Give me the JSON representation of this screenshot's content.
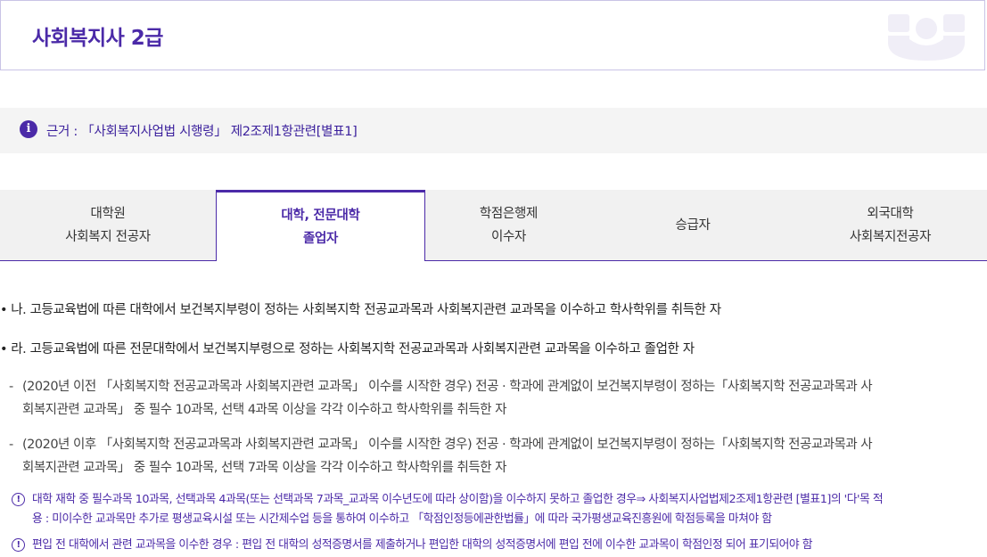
{
  "header": {
    "title": "사회복지사 2급",
    "logo_icon": "brand-logo-icon"
  },
  "notice": {
    "icon": "info-icon",
    "text": "근거 : 「사회복지사업법 시행령」 제2조제1항관련[별표1]"
  },
  "tabs": [
    {
      "line1": "대학원",
      "line2": "사회복지 전공자",
      "active": false
    },
    {
      "line1": "대학, 전문대학",
      "line2": "졸업자",
      "active": true
    },
    {
      "line1": "학점은행제",
      "line2": "이수자",
      "active": false
    },
    {
      "line1": "승급자",
      "line2": "",
      "active": false
    },
    {
      "line1": "외국대학",
      "line2": "사회복지전공자",
      "active": false
    }
  ],
  "content": {
    "bullets": [
      "나. 고등교육법에 따른 대학에서 보건복지부령이 정하는 사회복지학 전공교과목과 사회복지관련 교과목을 이수하고 학사학위를 취득한 자",
      "라. 고등교육법에 따른 전문대학에서 보건복지부령으로 정하는 사회복지학 전공교과목과 사회복지관련 교과목을 이수하고 졸업한 자"
    ],
    "dashes": [
      {
        "line1": "(2020년 이전 「사회복지학 전공교과목과 사회복지관련 교과목」 이수를 시작한 경우) 전공 · 학과에 관계없이 보건복지부령이 정하는「사회복지학 전공교과목과 사",
        "line2": "회복지관련 교과목」 중 필수 10과목, 선택 4과목 이상을 각각 이수하고 학사학위를 취득한 자"
      },
      {
        "line1": "(2020년 이후 「사회복지학 전공교과목과 사회복지관련 교과목」 이수를 시작한 경우) 전공 · 학과에 관계없이 보건복지부령이 정하는「사회복지학 전공교과목과 사",
        "line2": "회복지관련 교과목」 중 필수 10과목, 선택 7과목 이상을 각각 이수하고 학사학위를 취득한 자"
      }
    ],
    "cautions": [
      {
        "line1": "대학 재학 중 필수과목 10과목, 선택과목 4과목(또는 선택과목 7과목_교과목 이수년도에 따라 상이함)을 이수하지 못하고 졸업한 경우⇒ 사회복지사업법제2조제1항관련 [별표1]의 '다'목 적",
        "line2": "용 : 미이수한 교과목만 추가로 평생교육시설 또는 시간제수업 등을 통하여 이수하고 「학점인정등에관한법률」에 따라 국가평생교육진흥원에 학점등록을 마쳐야 함"
      },
      {
        "line1": "편입 전 대학에서 관련 교과목을 이수한 경우 : 편입 전 대학의 성적증명서를 제출하거나 편입한 대학의 성적증명서에 편입 전에 이수한 교과목이 학점인정 되어 표기되어야 함",
        "line2": ""
      }
    ]
  },
  "colors": {
    "accent": "#4b2aa8",
    "panel": "#f4f4f4",
    "tab_bg": "#f1f1f1"
  }
}
